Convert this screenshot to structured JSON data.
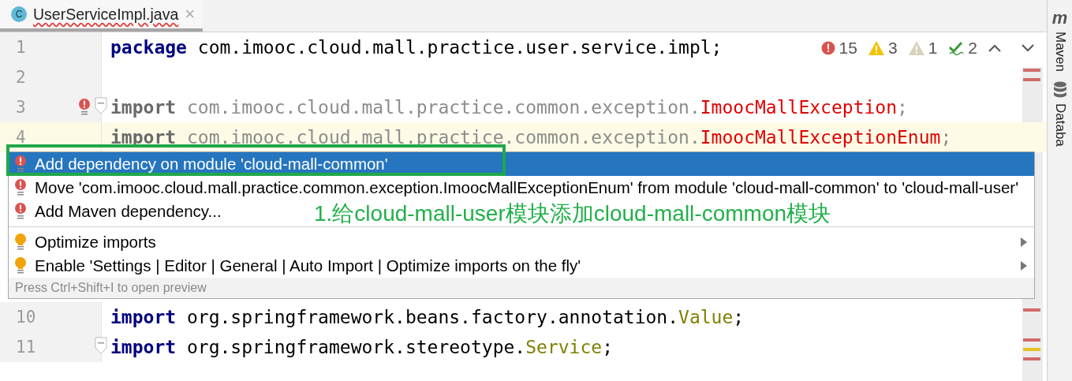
{
  "tab": {
    "icon_letter": "C",
    "title": "UserServiceImpl.java",
    "typo": true,
    "close": "×",
    "selected": true
  },
  "inspections": [
    {
      "kind": "error",
      "count": "15"
    },
    {
      "kind": "warning",
      "count": "3"
    },
    {
      "kind": "weak",
      "count": "1"
    },
    {
      "kind": "typo",
      "count": "2"
    }
  ],
  "lines": [
    {
      "number": "1",
      "segments": [
        {
          "kind": "keyword",
          "text": "package"
        },
        {
          "kind": "plain",
          "text": " com.imooc.cloud.mall.practice.user.service.impl;"
        }
      ]
    },
    {
      "number": "2",
      "marks": [
        {
          "color": "#d46a6a"
        },
        {
          "color": "#d46a6a"
        }
      ]
    },
    {
      "number": "3",
      "fold": true,
      "bulb": true,
      "segments": [
        {
          "kind": "unused-keyword",
          "text": "import"
        },
        {
          "kind": "unused",
          "text": " com.imooc.cloud.mall.practice.common.exception."
        },
        {
          "kind": "error",
          "text": "ImoocMallException"
        },
        {
          "kind": "unused",
          "text": ";"
        }
      ]
    },
    {
      "number": "4",
      "highlighted": true,
      "segments": [
        {
          "kind": "unused-keyword",
          "text": "import"
        },
        {
          "kind": "unused",
          "text": " com.imooc.cloud.mall.practice.common.exception."
        },
        {
          "kind": "error",
          "text": "ImoocMallExceptionEnum"
        },
        {
          "kind": "unused",
          "text": ";"
        }
      ]
    },
    {
      "number": "10",
      "marks": [
        {
          "color": "#d46a6a"
        }
      ],
      "segments": [
        {
          "kind": "keyword",
          "text": "import"
        },
        {
          "kind": "plain",
          "text": " org.springframework.beans.factory.annotation."
        },
        {
          "kind": "class",
          "text": "Value"
        },
        {
          "kind": "plain",
          "text": ";"
        }
      ]
    },
    {
      "number": "11",
      "fold": true,
      "marks": [
        {
          "color": "#d46a6a"
        },
        {
          "color": "#e8c020"
        },
        {
          "color": "#d46a6a"
        }
      ],
      "segments": [
        {
          "kind": "keyword",
          "text": "import"
        },
        {
          "kind": "plain",
          "text": " org.springframework.stereotype."
        },
        {
          "kind": "class",
          "text": "Service"
        },
        {
          "kind": "plain",
          "text": ";"
        }
      ]
    }
  ],
  "popup": {
    "items": [
      {
        "kind": "error",
        "text": "Add dependency on module 'cloud-mall-common'",
        "selected": true
      },
      {
        "kind": "error",
        "text": "Move 'com.imooc.cloud.mall.practice.common.exception.ImoocMallExceptionEnum' from module 'cloud-mall-common' to 'cloud-mall-user'",
        "selected": false
      },
      {
        "kind": "error",
        "text": "Add Maven dependency...",
        "selected": false
      },
      {
        "kind": "separator"
      },
      {
        "kind": "bulb",
        "text": "Optimize imports",
        "selected": false,
        "submenu": true
      },
      {
        "kind": "bulb",
        "text": "Enable 'Settings | Editor | General | Auto Import | Optimize imports on the fly'",
        "selected": false,
        "submenu": true
      }
    ],
    "footer": "Press Ctrl+Shift+I to open preview"
  },
  "annotation": {
    "text": "1.给cloud-mall-user模块添加cloud-mall-common模块"
  },
  "side_tools": [
    {
      "kind": "maven",
      "glyph": "m",
      "label": "Maven"
    },
    {
      "kind": "database",
      "label": "Databa"
    }
  ]
}
